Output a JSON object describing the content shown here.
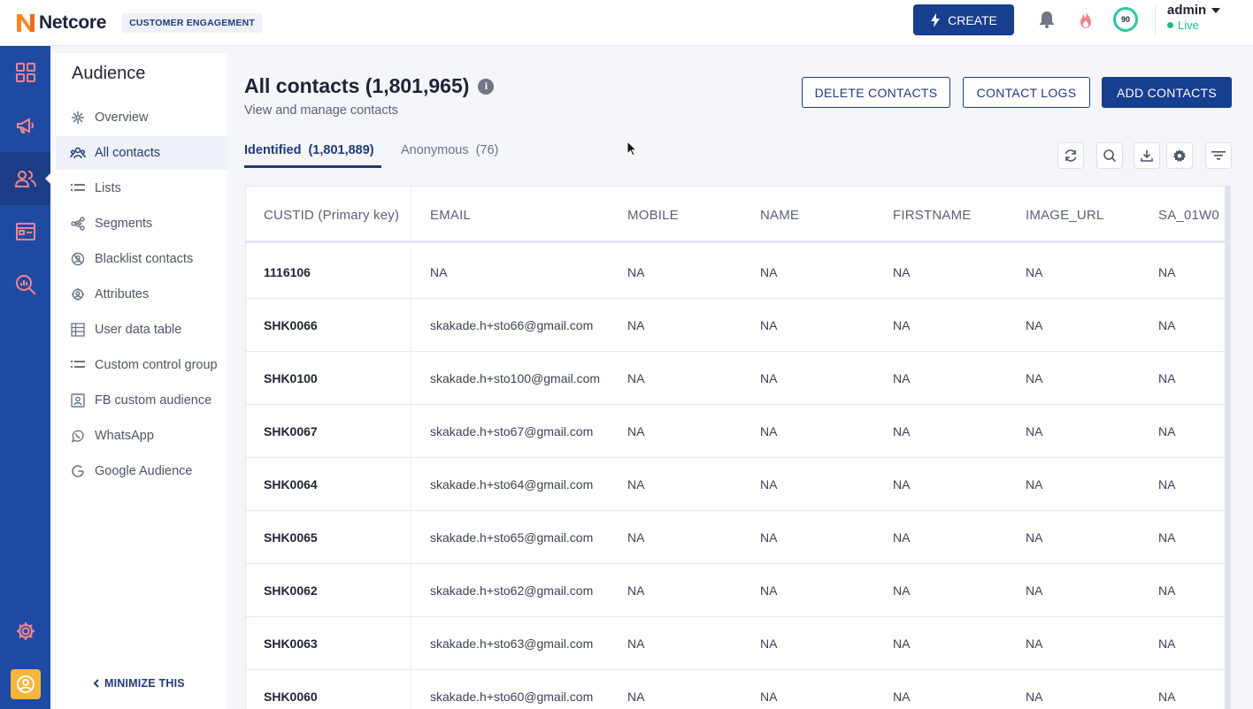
{
  "header": {
    "logo_text": "Netcore",
    "product_badge": "CUSTOMER ENGAGEMENT",
    "create_label": "CREATE",
    "score": "90",
    "user_name": "admin",
    "user_status": "Live",
    "colors": {
      "primary": "#173e8f",
      "brand_orange": "#f26b1d",
      "live_green": "#1fba8a"
    }
  },
  "rail": {
    "items": [
      "dashboard-icon",
      "megaphone-icon",
      "users-icon",
      "content-icon",
      "analytics-icon"
    ],
    "bottom": [
      "settings-icon",
      "profile-avatar"
    ]
  },
  "sidebar": {
    "title": "Audience",
    "items": [
      {
        "label": "Overview",
        "icon": "overview-icon"
      },
      {
        "label": "All contacts",
        "icon": "contacts-icon"
      },
      {
        "label": "Lists",
        "icon": "list-icon"
      },
      {
        "label": "Segments",
        "icon": "segments-icon"
      },
      {
        "label": "Blacklist contacts",
        "icon": "blacklist-icon"
      },
      {
        "label": "Attributes",
        "icon": "attributes-icon"
      },
      {
        "label": "User data table",
        "icon": "table-icon"
      },
      {
        "label": "Custom control group",
        "icon": "control-group-icon"
      },
      {
        "label": "FB custom audience",
        "icon": "fb-audience-icon"
      },
      {
        "label": "WhatsApp",
        "icon": "whatsapp-icon"
      },
      {
        "label": "Google Audience",
        "icon": "google-icon"
      }
    ],
    "minimize_label": "MINIMIZE THIS"
  },
  "main": {
    "title": "All contacts (1,801,965)",
    "subtitle": "View and manage contacts",
    "buttons": {
      "delete": "DELETE CONTACTS",
      "logs": "CONTACT LOGS",
      "add": "ADD CONTACTS"
    },
    "tabs": [
      {
        "label": "Identified",
        "count": "(1,801,889)"
      },
      {
        "label": "Anonymous",
        "count": "(76)"
      }
    ],
    "tools": [
      "refresh-icon",
      "search-icon",
      "download-icon",
      "settings-icon",
      "filter-icon"
    ]
  },
  "table": {
    "columns": [
      "CUSTID (Primary key)",
      "EMAIL",
      "MOBILE",
      "NAME",
      "FIRSTNAME",
      "IMAGE_URL",
      "SA_01W0"
    ],
    "rows": [
      [
        "1116106",
        "NA",
        "NA",
        "NA",
        "NA",
        "NA",
        "NA"
      ],
      [
        "SHK0066",
        "skakade.h+sto66@gmail.com",
        "NA",
        "NA",
        "NA",
        "NA",
        "NA"
      ],
      [
        "SHK0100",
        "skakade.h+sto100@gmail.com",
        "NA",
        "NA",
        "NA",
        "NA",
        "NA"
      ],
      [
        "SHK0067",
        "skakade.h+sto67@gmail.com",
        "NA",
        "NA",
        "NA",
        "NA",
        "NA"
      ],
      [
        "SHK0064",
        "skakade.h+sto64@gmail.com",
        "NA",
        "NA",
        "NA",
        "NA",
        "NA"
      ],
      [
        "SHK0065",
        "skakade.h+sto65@gmail.com",
        "NA",
        "NA",
        "NA",
        "NA",
        "NA"
      ],
      [
        "SHK0062",
        "skakade.h+sto62@gmail.com",
        "NA",
        "NA",
        "NA",
        "NA",
        "NA"
      ],
      [
        "SHK0063",
        "skakade.h+sto63@gmail.com",
        "NA",
        "NA",
        "NA",
        "NA",
        "NA"
      ],
      [
        "SHK0060",
        "skakade.h+sto60@gmail.com",
        "NA",
        "NA",
        "NA",
        "NA",
        "NA"
      ]
    ]
  }
}
